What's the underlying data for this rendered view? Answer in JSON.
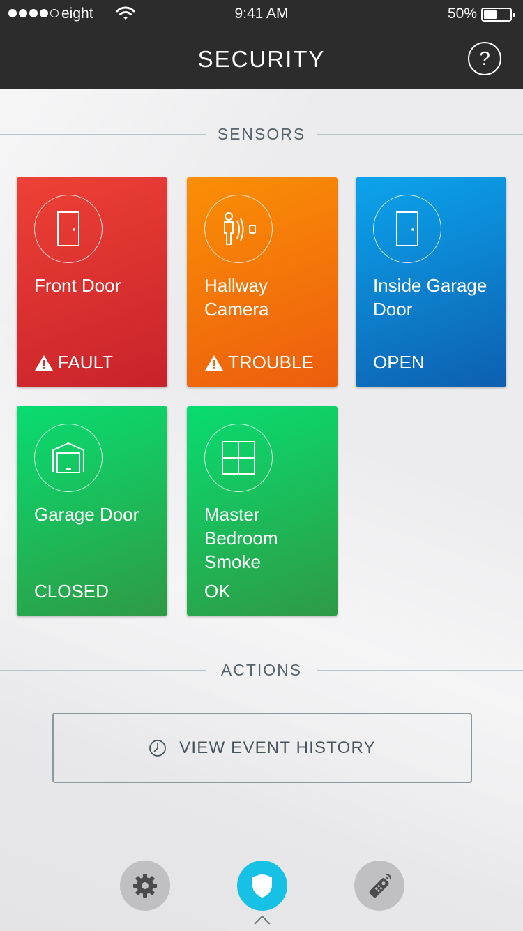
{
  "status_bar": {
    "carrier": "eight",
    "time": "9:41 AM",
    "battery_percent": "50%",
    "battery_level": 0.5
  },
  "nav": {
    "title": "SECURITY",
    "help_label": "?"
  },
  "sections": {
    "sensors": "SENSORS",
    "actions": "ACTIONS"
  },
  "sensors": [
    {
      "name": "Front Door",
      "state": "FAULT",
      "color": "#e33a32",
      "icon": "door-icon",
      "warning": true
    },
    {
      "name": "Hallway Camera",
      "state": "TROUBLE",
      "color": "#f57a08",
      "icon": "motion-sensor-icon",
      "warning": true
    },
    {
      "name": "Inside Garage Door",
      "state": "OPEN",
      "color": "#0a84d6",
      "icon": "door-icon",
      "warning": false
    },
    {
      "name": "Garage Door",
      "state": "CLOSED",
      "color": "#19c05a",
      "icon": "garage-door-icon",
      "warning": false
    },
    {
      "name": "Master Bedroom Smoke",
      "state": "OK",
      "color": "#19c05a",
      "icon": "window-icon",
      "warning": false
    }
  ],
  "actions": {
    "view_event_history": "VIEW EVENT HISTORY"
  },
  "tabbar": {
    "items": [
      {
        "icon": "gear-icon",
        "active": false
      },
      {
        "icon": "shield-icon",
        "active": true
      },
      {
        "icon": "remote-icon",
        "active": false
      }
    ],
    "active_color": "#17c1e6"
  }
}
